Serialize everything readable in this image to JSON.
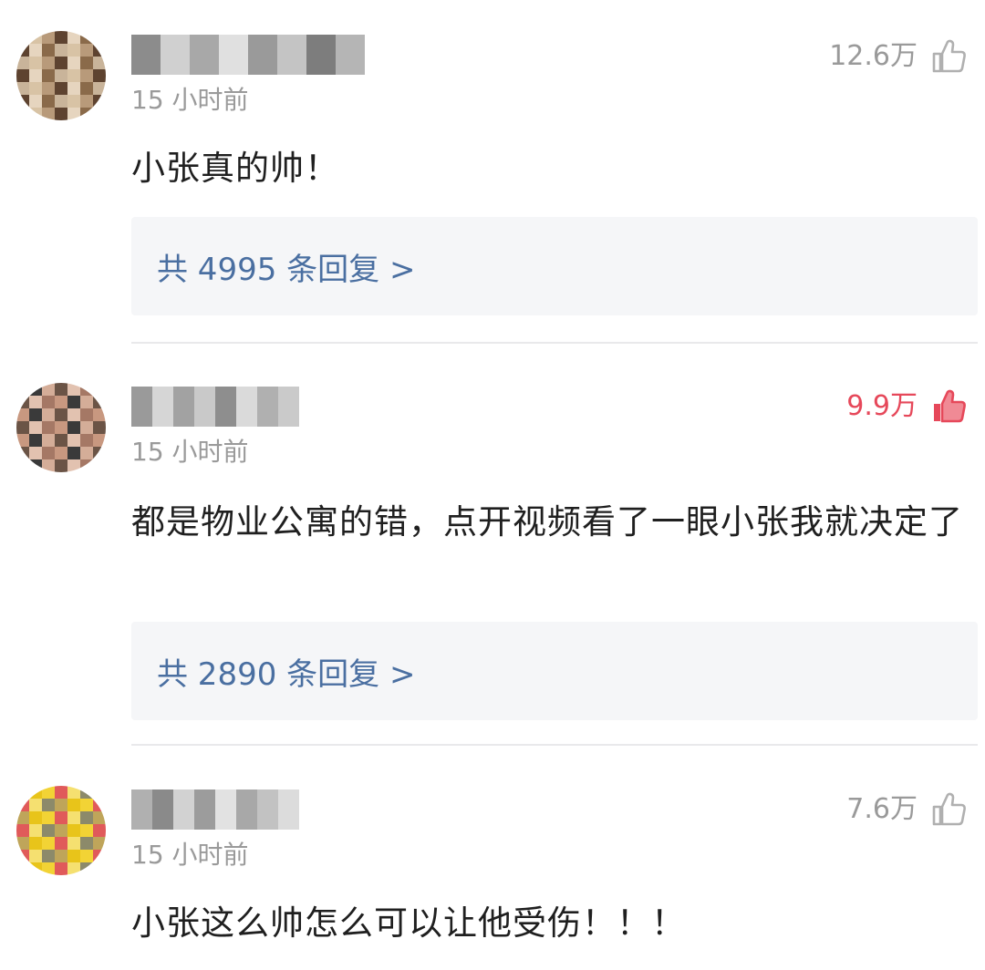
{
  "comments": [
    {
      "time": "15 小时前",
      "likes": "12.6万",
      "liked": false,
      "text": "小张真的帅！",
      "replies": "共 4995 条回复 >",
      "avatar_colors": [
        "#c9b49a",
        "#8a6a4a",
        "#e6d5bf",
        "#5e4330",
        "#b89a7a",
        "#d8c3a5"
      ],
      "username_colors": [
        "#8c8c8c",
        "#d0d0d0",
        "#a8a8a8",
        "#e0e0e0",
        "#9a9a9a",
        "#c4c4c4",
        "#7d7d7d",
        "#b5b5b5"
      ]
    },
    {
      "time": "15 小时前",
      "likes": "9.9万",
      "liked": true,
      "text": "都是物业公寓的错，点开视频看了一眼小张我就决定了",
      "replies": "共 2890 条回复 >",
      "avatar_colors": [
        "#3a3a3a",
        "#c89880",
        "#a57865",
        "#e2c2b0",
        "#6b5446",
        "#d4ad98"
      ],
      "username_colors": [
        "#9a9a9a",
        "#d6d6d6",
        "#a2a2a2",
        "#c9c9c9",
        "#8e8e8e",
        "#dadada",
        "#b0b0b0",
        "#cacaca"
      ]
    },
    {
      "time": "15 小时前",
      "likes": "7.6万",
      "liked": false,
      "text": "小张这么帅怎么可以让他受伤！！！",
      "avatar_colors": [
        "#f2d335",
        "#e8c41a",
        "#bfa55a",
        "#8c8a6a",
        "#f5e070",
        "#e05a5a"
      ],
      "username_colors": [
        "#b0b0b0",
        "#8a8a8a",
        "#d2d2d2",
        "#9c9c9c",
        "#e2e2e2",
        "#a8a8a8",
        "#c2c2c2",
        "#dcdcdc"
      ]
    }
  ]
}
